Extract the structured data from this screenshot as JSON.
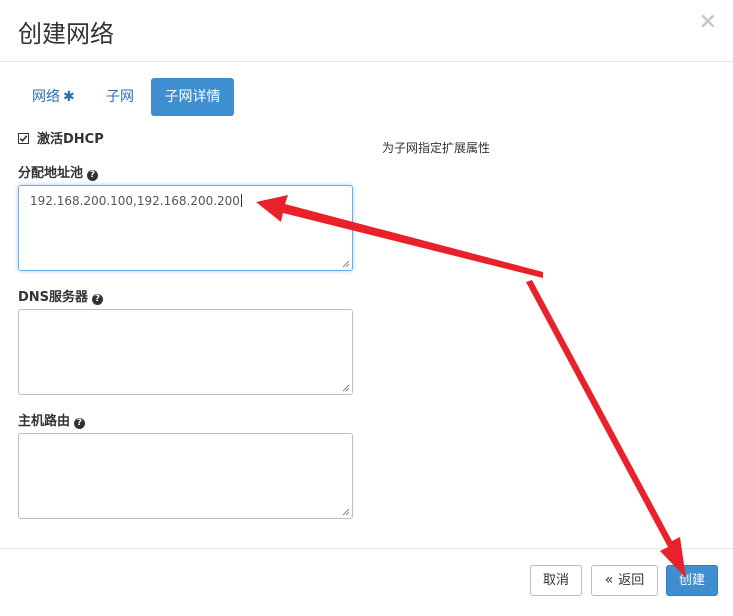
{
  "dialog": {
    "title": "创建网络",
    "close_symbol": "×"
  },
  "tabs": [
    {
      "label": "网络",
      "required_mark": "✱"
    },
    {
      "label": "子网"
    },
    {
      "label": "子网详情"
    }
  ],
  "form": {
    "enable_dhcp": {
      "label": "激活DHCP",
      "checked": true
    },
    "allocation_pools": {
      "label": "分配地址池",
      "value": "192.168.200.100,192.168.200.200"
    },
    "dns_servers": {
      "label": "DNS服务器",
      "value": ""
    },
    "host_routes": {
      "label": "主机路由",
      "value": ""
    },
    "help_symbol": "?"
  },
  "description": "为子网指定扩展属性",
  "footer": {
    "cancel_label": "取消",
    "back_symbol": "«",
    "back_label": "返回",
    "create_label": "创建"
  },
  "colors": {
    "primary": "#3e8ed0",
    "link": "#2a6fb0",
    "annotation_arrow": "#e8212a"
  }
}
